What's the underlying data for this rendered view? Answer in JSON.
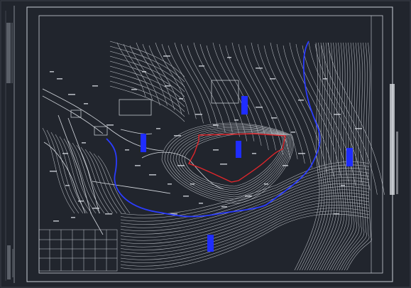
{
  "app": {
    "title": "",
    "background_color": "#21252d",
    "line_color": "#d8dce2",
    "accent_colors": {
      "boundary_red": "#e0262b",
      "water_blue": "#2b3cff",
      "marker_blue": "#1f2dff"
    }
  },
  "drawing": {
    "title_block_text": "",
    "side_vertical_label": "",
    "right_title_strip": ""
  }
}
